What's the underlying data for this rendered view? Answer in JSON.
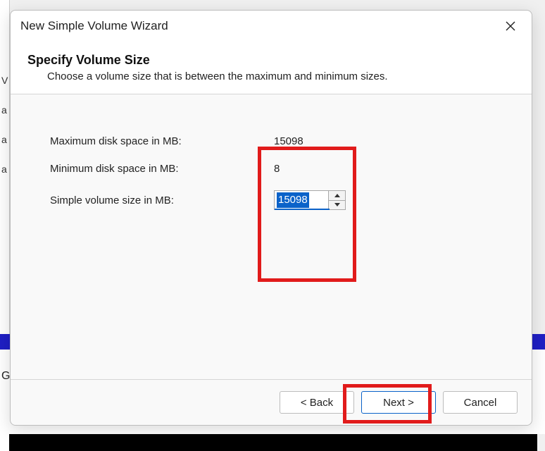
{
  "window": {
    "title": "New Simple Volume Wizard"
  },
  "header": {
    "title": "Specify Volume Size",
    "subtitle": "Choose a volume size that is between the maximum and minimum sizes."
  },
  "form": {
    "max_label": "Maximum disk space in MB:",
    "max_value": "15098",
    "min_label": "Minimum disk space in MB:",
    "min_value": "8",
    "size_label": "Simple volume size in MB:",
    "size_value": "15098"
  },
  "buttons": {
    "back": "< Back",
    "next": "Next >",
    "cancel": "Cancel"
  }
}
